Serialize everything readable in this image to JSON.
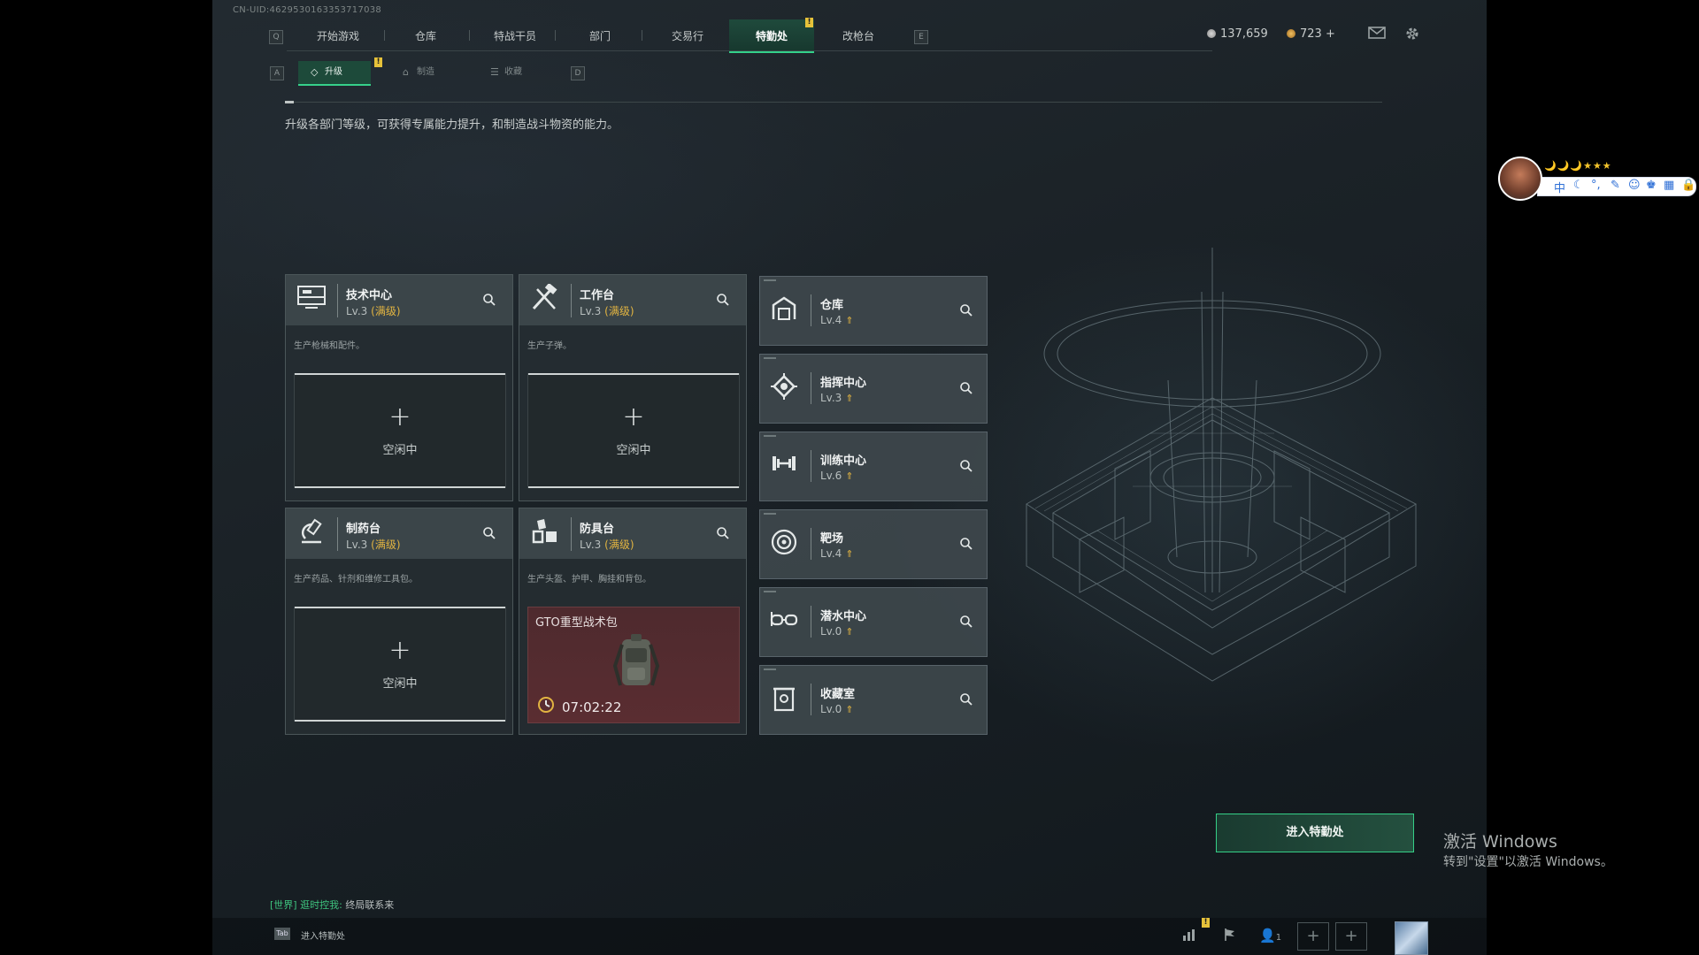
{
  "uid": "CN-UID:4629530163353717038",
  "topbar": {
    "left_key": "Q",
    "right_key": "E",
    "tabs": [
      {
        "label": "开始游戏"
      },
      {
        "label": "仓库"
      },
      {
        "label": "特战干员"
      },
      {
        "label": "部门"
      },
      {
        "label": "交易行"
      },
      {
        "label": "特勤处",
        "active": true,
        "badge": "!"
      },
      {
        "label": "改枪台"
      }
    ],
    "currency_primary": "137,659",
    "currency_secondary": "723 +"
  },
  "subtabs": {
    "left_key": "A",
    "right_key": "D",
    "items": [
      {
        "label": "升级",
        "icon": "upgrade-icon",
        "active": true,
        "badge": "!"
      },
      {
        "label": "制造",
        "icon": "craft-icon"
      },
      {
        "label": "收藏",
        "icon": "collection-icon"
      }
    ]
  },
  "description": "升级各部门等级，可获得专属能力提升，和制造战斗物资的能力。",
  "workbenches": [
    {
      "name": "技术中心",
      "level": "Lv.3",
      "max_label": "(满级)",
      "desc": "生产枪械和配件。",
      "icon": "tech-center-icon",
      "slot": {
        "status": "空闲中"
      }
    },
    {
      "name": "工作台",
      "level": "Lv.3",
      "max_label": "(满级)",
      "desc": "生产子弹。",
      "icon": "workbench-icon",
      "slot": {
        "status": "空闲中"
      }
    },
    {
      "name": "制药台",
      "level": "Lv.3",
      "max_label": "(满级)",
      "desc": "生产药品、针剂和维修工具包。",
      "icon": "pharmacy-icon",
      "slot": {
        "status": "空闲中"
      }
    },
    {
      "name": "防具台",
      "level": "Lv.3",
      "max_label": "(满级)",
      "desc": "生产头盔、护甲、胸挂和背包。",
      "icon": "armor-bench-icon",
      "crafting": {
        "item": "GTO重型战术包",
        "time_left": "07:02:22"
      }
    }
  ],
  "facilities": [
    {
      "name": "仓库",
      "level": "Lv.4",
      "icon": "warehouse-icon"
    },
    {
      "name": "指挥中心",
      "level": "Lv.3",
      "icon": "command-center-icon"
    },
    {
      "name": "训练中心",
      "level": "Lv.6",
      "icon": "training-center-icon"
    },
    {
      "name": "靶场",
      "level": "Lv.4",
      "icon": "shooting-range-icon"
    },
    {
      "name": "潜水中心",
      "level": "Lv.0",
      "icon": "diving-center-icon"
    },
    {
      "name": "收藏室",
      "level": "Lv.0",
      "icon": "collection-room-icon"
    }
  ],
  "enter_button": "进入特勤处",
  "chat": {
    "channel": "[世界]",
    "sender": "逛时控我:",
    "message": "终局联系来"
  },
  "bottom": {
    "tab_key": "Tab",
    "tab_label": "进入特勤处",
    "friends_count": "1",
    "badge": "!"
  },
  "watermark": {
    "line1": "激活 Windows",
    "line2": "转到\"设置\"以激活 Windows。"
  },
  "ime": {
    "stars": "🌙🌙🌙★★★",
    "mode": "中"
  },
  "colors": {
    "accent": "#36d18b",
    "max_level": "#e2b441",
    "crafting_bg": "#5a2d31"
  }
}
